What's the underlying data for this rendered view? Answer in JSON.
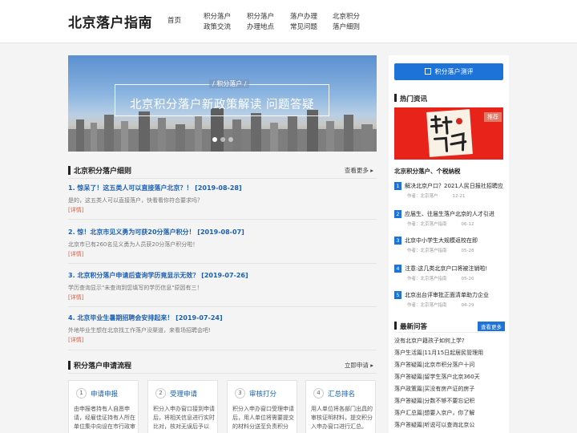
{
  "header": {
    "logo": "北京落户指南",
    "nav": [
      {
        "line1": "首页",
        "line2": ""
      },
      {
        "line1": "积分落户",
        "line2": "政策交流"
      },
      {
        "line1": "积分落户",
        "line2": "办理地点"
      },
      {
        "line1": "落户办理",
        "line2": "常见问题"
      },
      {
        "line1": "北京积分",
        "line2": "落户细则"
      }
    ]
  },
  "banner": {
    "tag": "/ 积分落户 /",
    "title": "北京积分落户新政策解读  问题答疑"
  },
  "details_section": {
    "title": "北京积分落户细则",
    "more": "查看更多 ▸",
    "articles": [
      {
        "title": "1. 惊呆了！这五类人可以直接落户北京？！ [2019-08-28]",
        "desc": "是的，这五类人可以直接落户，快看看你符合要求吗？",
        "more": "[详情]"
      },
      {
        "title": "2. 惊！北京市见义勇为可获20分落户积分！ [2019-08-07]",
        "desc": "北京市已有260名见义勇为人员获20分落户积分啦！",
        "more": "[详情]"
      },
      {
        "title": "3. 北京积分落户申请后查询学历竟显示无效？ [2019-07-26]",
        "desc": "学历查询显示\"未查询到您填写的学历信息\"原因有三！",
        "more": "[详情]"
      },
      {
        "title": "4. 北京毕业生暑期招聘会安排起来！ [2019-07-24]",
        "desc": "外地毕业生想在北京找工作落户没渠道，来看场招聘会吧!",
        "more": "[详情]"
      }
    ]
  },
  "process_section": {
    "title": "积分落户申请流程",
    "more": "立即申请 ▸",
    "steps": [
      {
        "num": "1",
        "label": "申请申报",
        "desc": "由申报者持有人自愿申请，经雇佳证持有人所在单位集中向设在市行政审"
      },
      {
        "num": "2",
        "label": "受理申请",
        "desc": "积分入申办窗口接到申请后，将相关信息进行实时比对，核对无误后予以"
      },
      {
        "num": "3",
        "label": "审核打分",
        "desc": "积分入申办窗口受理申请后，用人单位将需要提交的材料分送至负责积分"
      },
      {
        "num": "4",
        "label": "汇总排名",
        "desc": "用人单位将各部门出具的审核证明材料，提交积分入申办窗口进行汇总。"
      }
    ]
  },
  "sidebar": {
    "eval_button": "积分落户测评",
    "hot_title": "热门资讯",
    "hot_badge": "推荐",
    "hot_caption": "北京积分落户、个税纳税",
    "hot_items": [
      {
        "num": "1",
        "title": "解决北京户口？2021人民日报社招聘应",
        "author": "作者：北京落户",
        "date": "12-21"
      },
      {
        "num": "2",
        "title": "应届生、往届生落户北京的人才引进",
        "author": "作者：北京落户指南",
        "date": "06-12"
      },
      {
        "num": "3",
        "title": "北京中小学生大规模返校在即",
        "author": "作者：北京落户指南",
        "date": "05-28"
      },
      {
        "num": "4",
        "title": "注意:这几类北京户口将被注销啦!",
        "author": "作者：北京落户指南",
        "date": "05-20"
      },
      {
        "num": "5",
        "title": "北京出台评审批正面清单助力企业",
        "author": "作者：北京落户指南",
        "date": "04-29"
      }
    ],
    "qa_title": "最新问答",
    "qa_more": "查看更多",
    "qa_items": [
      "没有北京户籍孩子如何上学?",
      "落户生活篇|11月15日起居民管理用",
      "落户答疑篇|北京市积分落户十问",
      "落户答疑篇|留学生落户北京360天",
      "落户政策篇|买没有房产证的房子",
      "落户答疑篇|分数不够不要忘记积",
      "落户汇总篇|想要入京户，你了解",
      "落户答疑篇|听说可以查询北京公"
    ]
  }
}
